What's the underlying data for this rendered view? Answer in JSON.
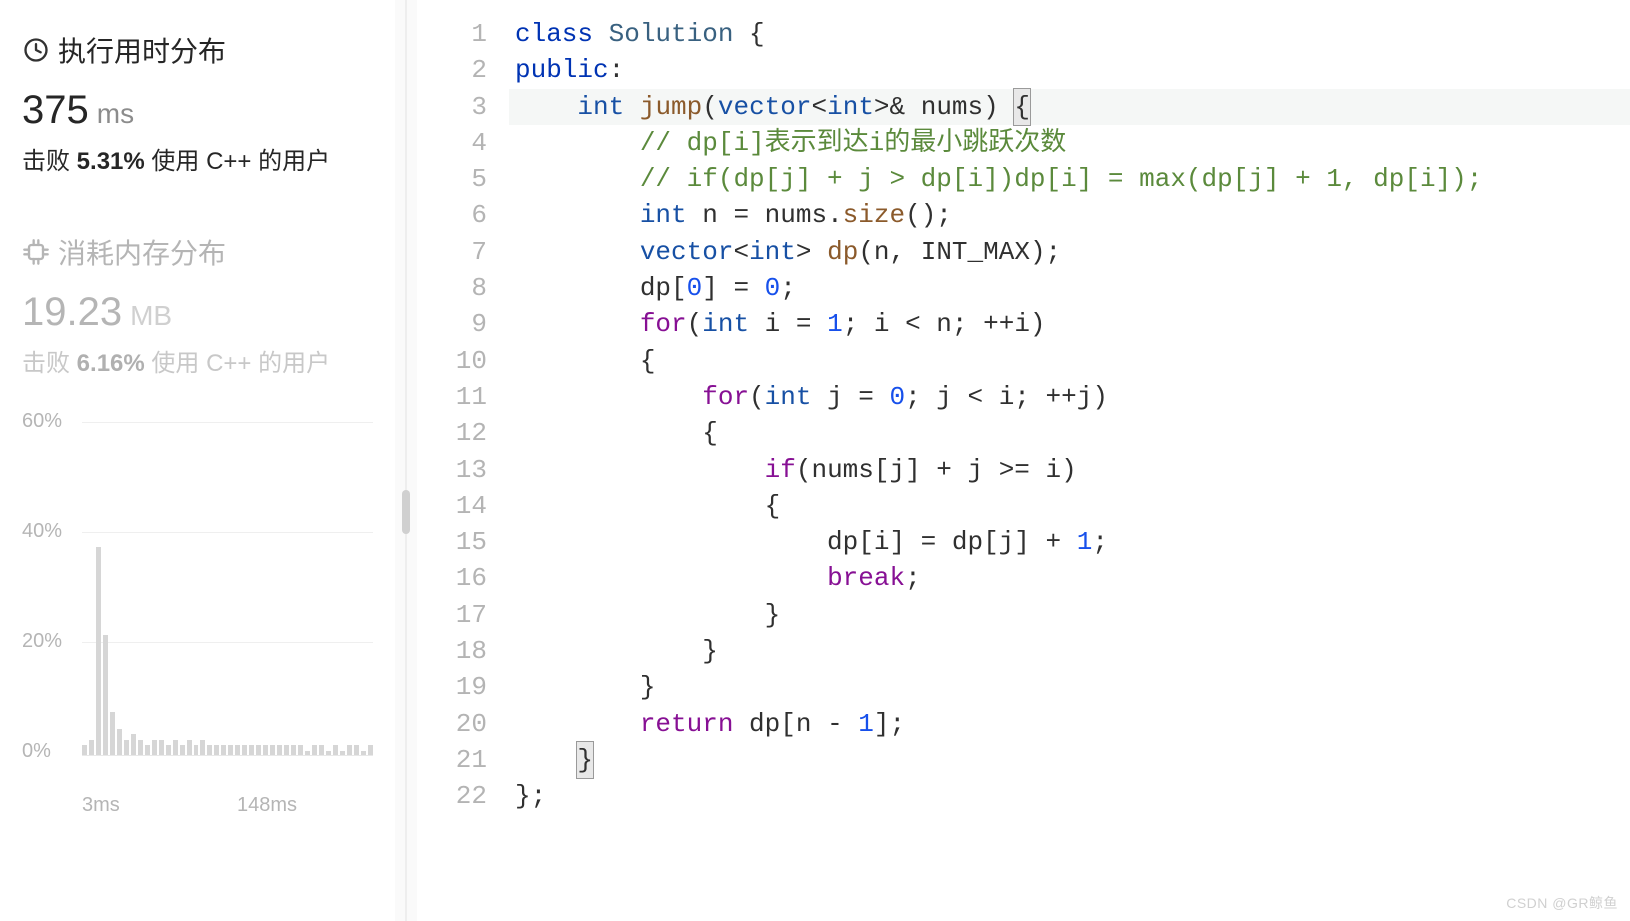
{
  "sidebar": {
    "runtime": {
      "title": "执行用时分布",
      "value": "375",
      "unit": "ms",
      "beat_prefix": "击败",
      "beat_pct": "5.31%",
      "beat_suffix": "使用 C++ 的用户"
    },
    "memory": {
      "title": "消耗内存分布",
      "value": "19.23",
      "unit": "MB",
      "beat_prefix": "击败",
      "beat_pct": "6.16%",
      "beat_suffix": "使用 C++ 的用户"
    }
  },
  "chart_data": {
    "type": "bar",
    "title": "消耗内存分布",
    "xlabel": "",
    "ylabel": "",
    "ylim": [
      0,
      60
    ],
    "y_ticks": [
      "60%",
      "40%",
      "20%",
      "0%"
    ],
    "x_ticks": [
      "3ms",
      "148ms"
    ],
    "categories_note": "~42 latency buckets starting at 3ms spaced ≈3.5ms",
    "values_pct": [
      2,
      3,
      38,
      22,
      8,
      5,
      3,
      4,
      3,
      2,
      3,
      3,
      2,
      3,
      2,
      3,
      2,
      3,
      2,
      2,
      2,
      2,
      2,
      2,
      2,
      2,
      2,
      2,
      2,
      2,
      2,
      2,
      1,
      2,
      2,
      1,
      2,
      1,
      2,
      2,
      1,
      2
    ]
  },
  "code": {
    "lines": [
      [
        [
          "kw",
          "class"
        ],
        [
          "op",
          " "
        ],
        [
          "ident",
          "Solution"
        ],
        [
          "op",
          " {"
        ]
      ],
      [
        [
          "kw",
          "public"
        ],
        [
          "op",
          ":"
        ]
      ],
      [
        [
          "op",
          "    "
        ],
        [
          "type",
          "int"
        ],
        [
          "op",
          " "
        ],
        [
          "fn",
          "jump"
        ],
        [
          "op",
          "("
        ],
        [
          "type",
          "vector"
        ],
        [
          "op",
          "<"
        ],
        [
          "type",
          "int"
        ],
        [
          "op",
          ">& nums) "
        ],
        [
          "brhl",
          "{"
        ]
      ],
      [
        [
          "op",
          "        "
        ],
        [
          "cmt",
          "// dp[i]表示到达i的最小跳跃次数"
        ]
      ],
      [
        [
          "op",
          "        "
        ],
        [
          "cmt",
          "// if(dp[j] + j > dp[i])dp[i] = max(dp[j] + 1, dp[i]);"
        ]
      ],
      [
        [
          "op",
          "        "
        ],
        [
          "type",
          "int"
        ],
        [
          "op",
          " n = nums."
        ],
        [
          "fn",
          "size"
        ],
        [
          "op",
          "();"
        ]
      ],
      [
        [
          "op",
          "        "
        ],
        [
          "type",
          "vector"
        ],
        [
          "op",
          "<"
        ],
        [
          "type",
          "int"
        ],
        [
          "op",
          "> "
        ],
        [
          "fn",
          "dp"
        ],
        [
          "op",
          "(n, INT_MAX);"
        ]
      ],
      [
        [
          "op",
          "        dp["
        ],
        [
          "num",
          "0"
        ],
        [
          "op",
          "] = "
        ],
        [
          "num",
          "0"
        ],
        [
          "op",
          ";"
        ]
      ],
      [
        [
          "op",
          "        "
        ],
        [
          "kw2",
          "for"
        ],
        [
          "op",
          "("
        ],
        [
          "type",
          "int"
        ],
        [
          "op",
          " i = "
        ],
        [
          "num",
          "1"
        ],
        [
          "op",
          "; i < n; ++i)"
        ]
      ],
      [
        [
          "op",
          "        {"
        ]
      ],
      [
        [
          "op",
          "            "
        ],
        [
          "kw2",
          "for"
        ],
        [
          "op",
          "("
        ],
        [
          "type",
          "int"
        ],
        [
          "op",
          " j = "
        ],
        [
          "num",
          "0"
        ],
        [
          "op",
          "; j < i; ++j)"
        ]
      ],
      [
        [
          "op",
          "            {"
        ]
      ],
      [
        [
          "op",
          "                "
        ],
        [
          "kw2",
          "if"
        ],
        [
          "op",
          "(nums[j] + j >= i)"
        ]
      ],
      [
        [
          "op",
          "                {"
        ]
      ],
      [
        [
          "op",
          "                    dp[i] = dp[j] + "
        ],
        [
          "num",
          "1"
        ],
        [
          "op",
          ";"
        ]
      ],
      [
        [
          "op",
          "                    "
        ],
        [
          "kw2",
          "break"
        ],
        [
          "op",
          ";"
        ]
      ],
      [
        [
          "op",
          "                }"
        ]
      ],
      [
        [
          "op",
          "            }"
        ]
      ],
      [
        [
          "op",
          "        }"
        ]
      ],
      [
        [
          "op",
          "        "
        ],
        [
          "kw2",
          "return"
        ],
        [
          "op",
          " dp[n - "
        ],
        [
          "num",
          "1"
        ],
        [
          "op",
          "];"
        ]
      ],
      [
        [
          "op",
          "    "
        ],
        [
          "brhl",
          "}"
        ]
      ],
      [
        [
          "op",
          "};"
        ]
      ]
    ],
    "highlight_line": 3
  },
  "watermark": "CSDN @GR鲸鱼"
}
